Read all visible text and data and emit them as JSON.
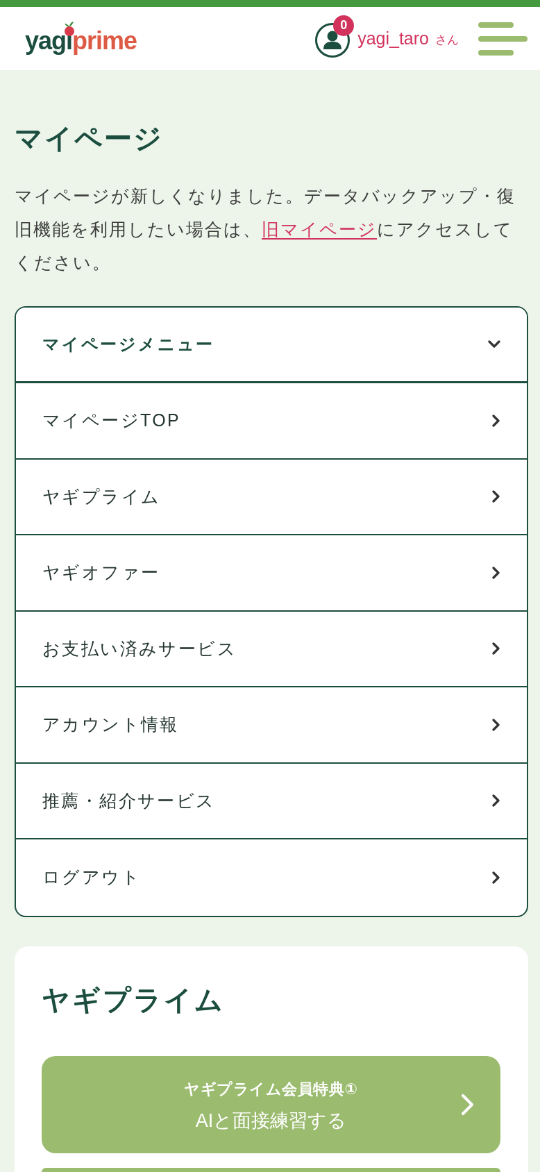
{
  "header": {
    "logo": {
      "first": "yagi",
      "second": "prime"
    },
    "notification_count": "0",
    "username": "yagi_taro",
    "honorific": "さん"
  },
  "page": {
    "title": "マイページ",
    "notice": {
      "before": "マイページが新しくなりました。データバックアップ・復旧機能を利用したい場合は、",
      "link": "旧マイページ",
      "after": "にアクセスしてください。"
    }
  },
  "menu": {
    "title": "マイページメニュー",
    "expanded": true,
    "items": [
      {
        "label": "マイページTOP"
      },
      {
        "label": "ヤギプライム"
      },
      {
        "label": "ヤギオファー"
      },
      {
        "label": "お支払い済みサービス"
      },
      {
        "label": "アカウント情報"
      },
      {
        "label": "推薦・紹介サービス"
      },
      {
        "label": "ログアウト"
      }
    ]
  },
  "prime": {
    "title": "ヤギプライム",
    "buttons": [
      {
        "kind": "full",
        "caption": "ヤギプライム会員特典①",
        "label": "AIと面接練習する"
      },
      {
        "kind": "partial"
      }
    ]
  }
}
